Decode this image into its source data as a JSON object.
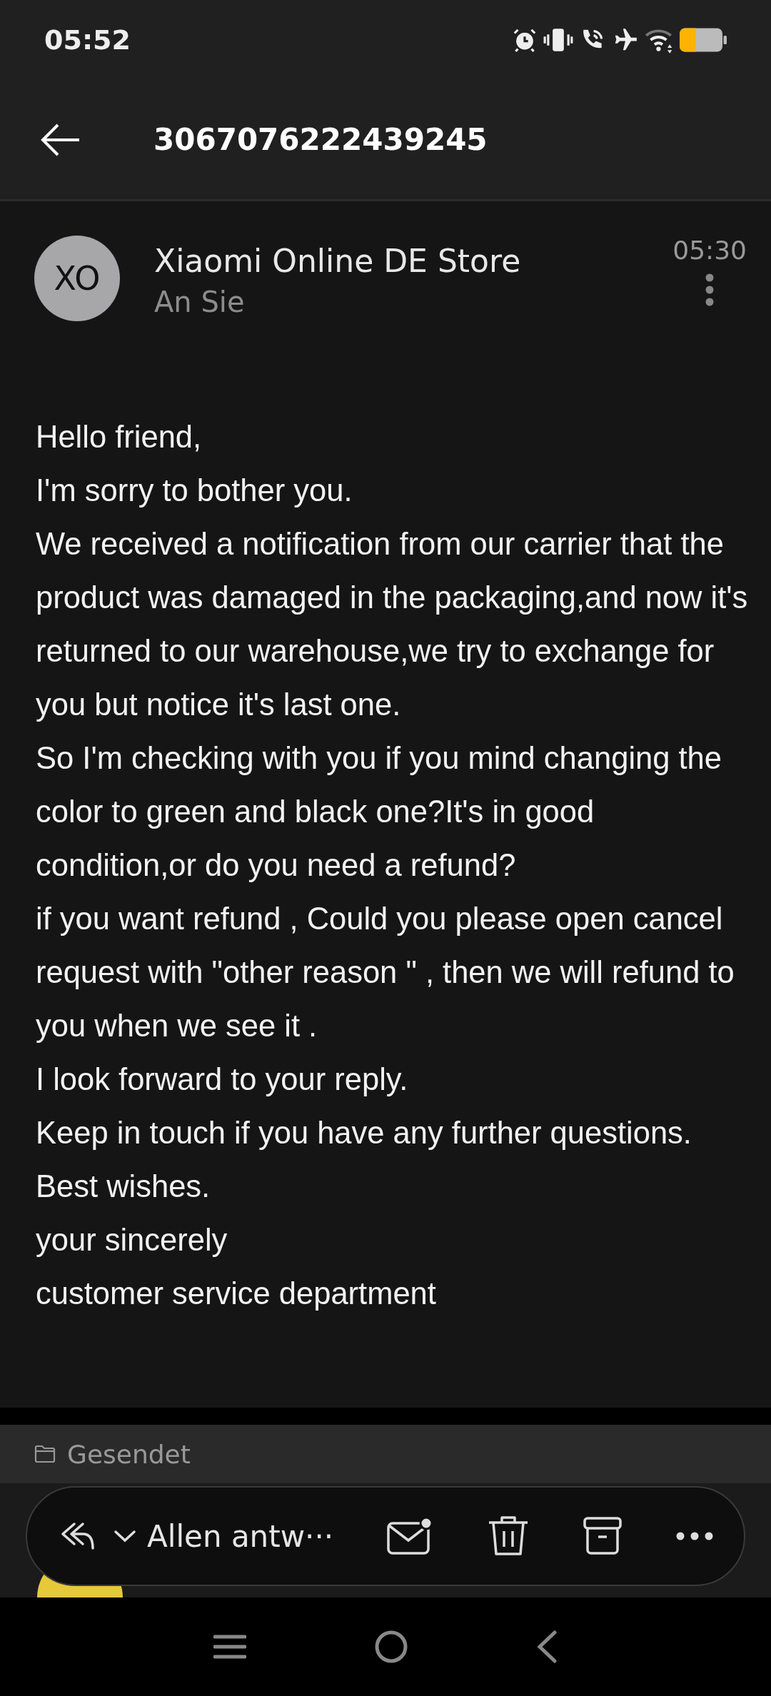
{
  "status_bar": {
    "time": "05:52"
  },
  "app_bar": {
    "title": "3067076222439245"
  },
  "message": {
    "avatar": "XO",
    "sender": "Xiaomi Online DE Store",
    "recipient": "An Sie",
    "time": "05:30",
    "body": [
      "Hello friend,",
      "I'm sorry to bother you.",
      "We received a notification from our carrier that the product was damaged in the packaging,and now it's returned to our warehouse,we try to exchange for you but notice it's last one.",
      "So I'm checking with you if you mind changing the color to green and black one?It's in good condition,or do you need a refund?",
      "if you want refund , Could you please open cancel request with \"other reason \" , then we will refund to you when we see it .",
      "I look forward to your reply.",
      "Keep in touch if you have any further questions.",
      "Best wishes.",
      "your sincerely",
      "customer service department"
    ]
  },
  "folder": "Gesendet",
  "toolbar": {
    "reply_label": "Allen antw···",
    "unread_dot": true
  }
}
